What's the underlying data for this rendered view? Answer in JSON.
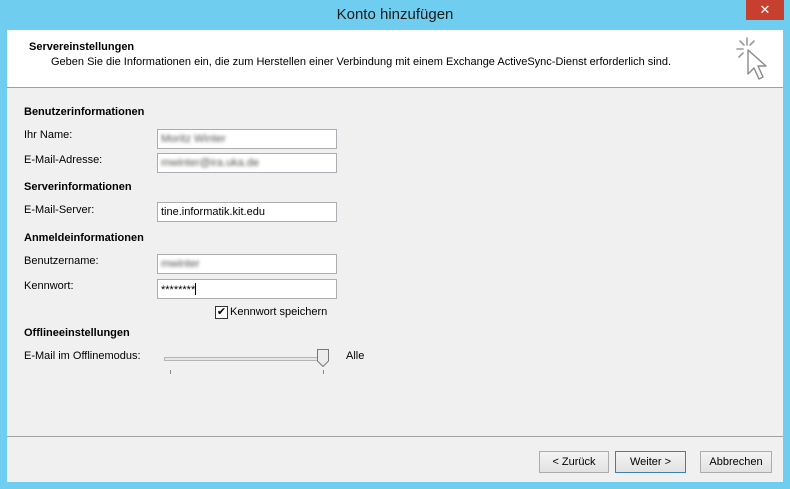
{
  "window": {
    "title": "Konto hinzufügen",
    "close_glyph": "✕"
  },
  "header": {
    "title": "Servereinstellungen",
    "description": "Geben Sie die Informationen ein, die zum Herstellen einer Verbindung mit einem Exchange ActiveSync-Dienst erforderlich sind.",
    "icon": "cursor-click-icon"
  },
  "user_info": {
    "title": "Benutzerinformationen",
    "name_label": "Ihr Name:",
    "name_value": "Moritz Winter",
    "email_label": "E-Mail-Adresse:",
    "email_value": "mwinter@ira.uka.de"
  },
  "server_info": {
    "title": "Serverinformationen",
    "server_label": "E-Mail-Server:",
    "server_value": "tine.informatik.kit.edu"
  },
  "login_info": {
    "title": "Anmeldeinformationen",
    "username_label": "Benutzername:",
    "username_value": "mwinter",
    "password_label": "Kennwort:",
    "password_value": "********",
    "remember_label": "Kennwort speichern",
    "remember_checked": true,
    "check_glyph": "✔"
  },
  "offline": {
    "title": "Offlineeinstellungen",
    "mode_label": "E-Mail im Offlinemodus:",
    "mode_value": "Alle",
    "slider_level": 1.0
  },
  "buttons": {
    "back": "< Zurück",
    "next": "Weiter >",
    "cancel": "Abbrechen"
  }
}
